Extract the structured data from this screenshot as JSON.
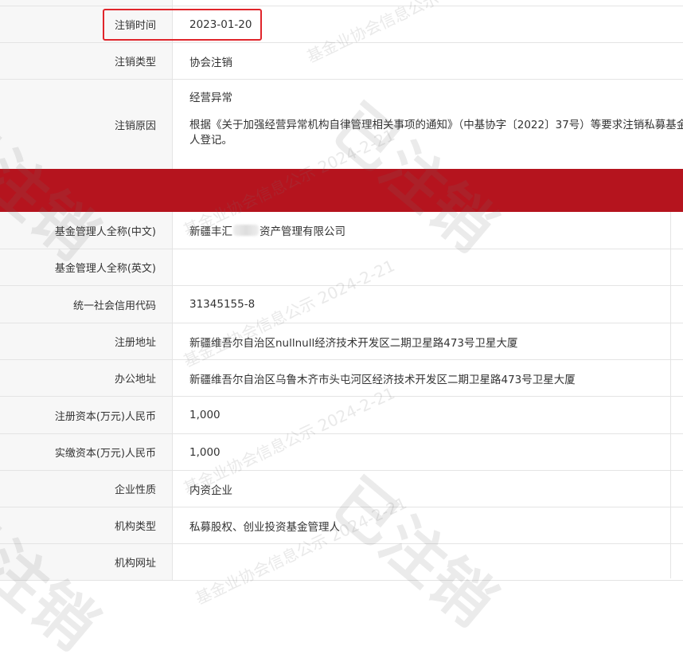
{
  "section_top": [
    {
      "label": "注销时间",
      "value": "2023-01-20"
    },
    {
      "label": "注销类型",
      "value": "协会注销"
    }
  ],
  "cancel_reason": {
    "label": "注销原因",
    "line1": "经营异常",
    "line2": "根据《关于加强经营异常机构自律管理相关事项的通知》（中基协字〔2022〕37号）等要求注销私募基金管理人登记。"
  },
  "section_bottom": {
    "name_cn_label": "基金管理人全称(中文)",
    "name_cn_prefix": "新疆丰汇",
    "name_cn_suffix": "资产管理有限公司",
    "name_en_label": "基金管理人全称(英文)",
    "name_en_value": "",
    "credit_label": "统一社会信用代码",
    "credit_value": "31345155-8",
    "reg_addr_label": "注册地址",
    "reg_addr_value": "新疆维吾尔自治区nullnull经济技术开发区二期卫星路473号卫星大厦",
    "office_addr_label": "办公地址",
    "office_addr_value": "新疆维吾尔自治区乌鲁木齐市头屯河区经济技术开发区二期卫星路473号卫星大厦",
    "reg_capital_label": "注册资本(万元)人民币",
    "reg_capital_value": "1,000",
    "paid_capital_label": "实缴资本(万元)人民币",
    "paid_capital_value": "1,000",
    "nature_label": "企业性质",
    "nature_value": "内资企业",
    "type_label": "机构类型",
    "type_value": "私募股权、创业投资基金管理人",
    "website_label": "机构网址",
    "website_value": ""
  },
  "watermarks": {
    "text": "基金业协会信息公示 2024-2-21",
    "stamp": "已注销"
  },
  "colors": {
    "red_bar": "#b5141e",
    "highlight_border": "#e0252b",
    "label_bg": "#f7f7f7",
    "border": "#e4e4e4"
  }
}
